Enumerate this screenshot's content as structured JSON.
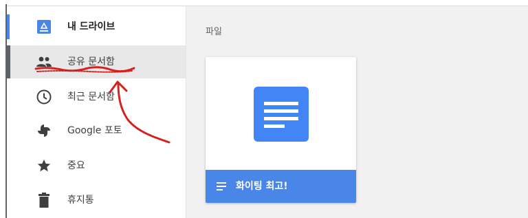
{
  "sidebar": {
    "items": [
      {
        "label": "내 드라이브",
        "icon": "drive-icon"
      },
      {
        "label": "공유 문서함",
        "icon": "people-icon",
        "active": true
      },
      {
        "label": "최근 문서함",
        "icon": "clock-icon"
      },
      {
        "label": "Google 포토",
        "icon": "photos-icon"
      },
      {
        "label": "중요",
        "icon": "star-icon"
      },
      {
        "label": "휴지통",
        "icon": "trash-icon"
      }
    ]
  },
  "main": {
    "section_title": "파일",
    "files": [
      {
        "name": "화이팅 최고!",
        "type": "docs-icon"
      }
    ]
  },
  "colors": {
    "accent": "#4285f4",
    "card_footer": "#4a86e8",
    "active_bg": "#e8e8e8",
    "annotation": "#d62020"
  }
}
